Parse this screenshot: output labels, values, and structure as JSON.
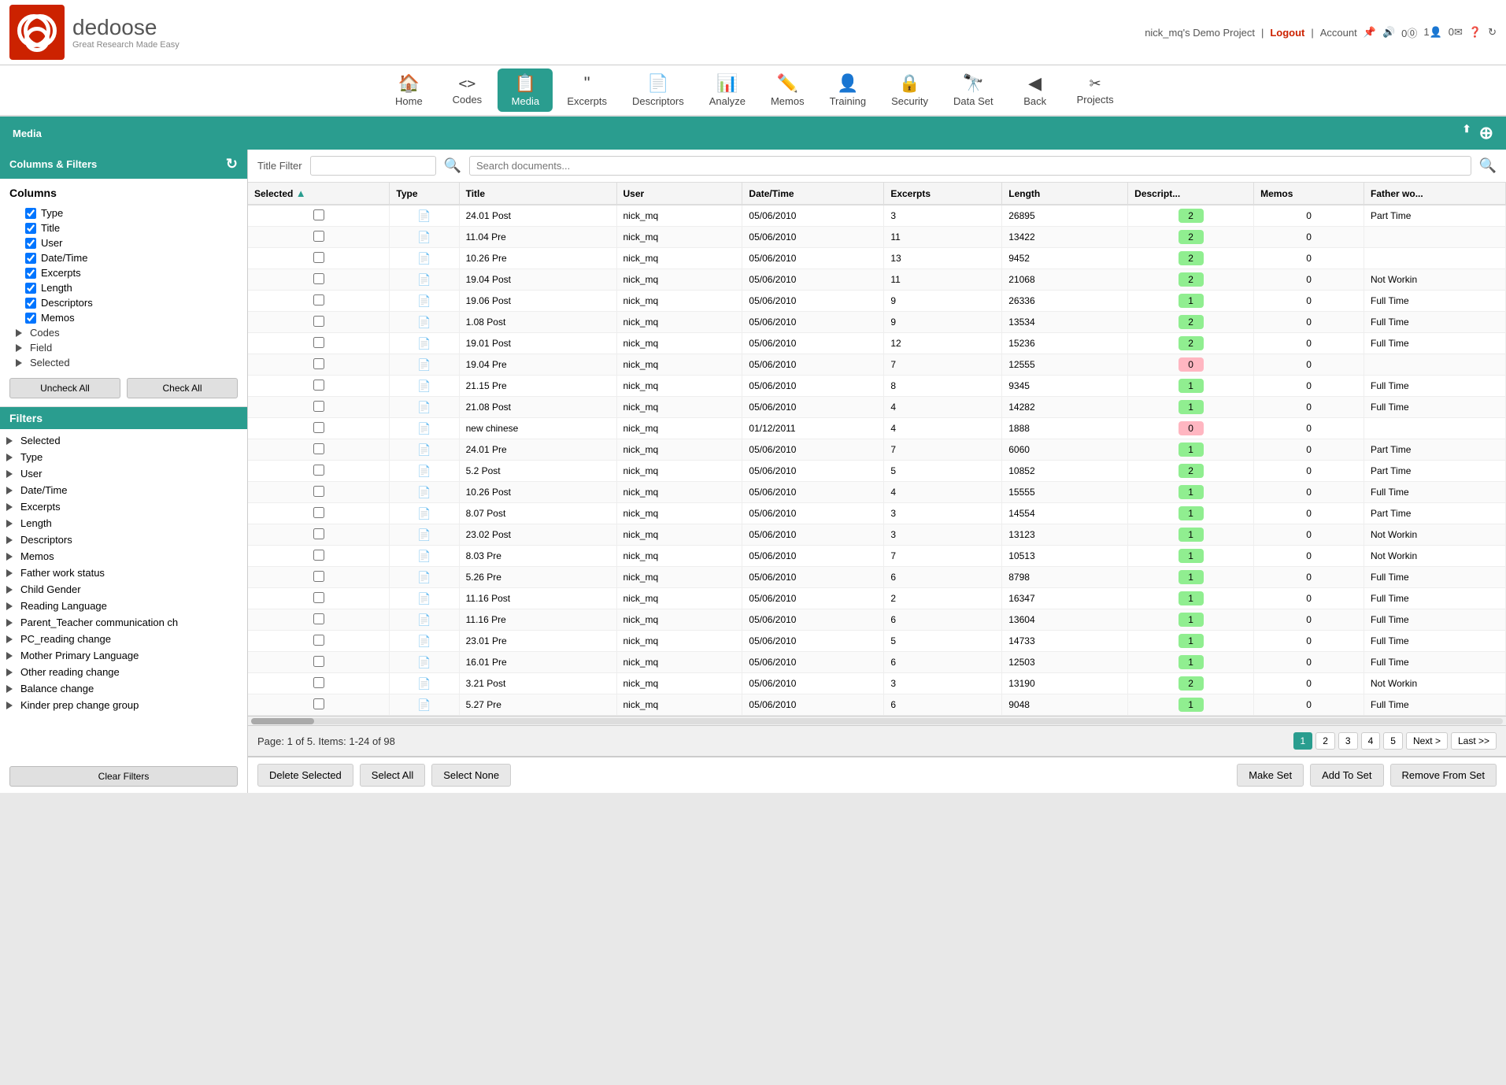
{
  "topbar": {
    "project": "nick_mq's Demo Project",
    "logout": "Logout",
    "account": "Account"
  },
  "nav": {
    "items": [
      {
        "id": "home",
        "label": "Home",
        "icon": "🏠"
      },
      {
        "id": "codes",
        "label": "Codes",
        "icon": "⟨⟩"
      },
      {
        "id": "media",
        "label": "Media",
        "icon": "📋",
        "active": true
      },
      {
        "id": "excerpts",
        "label": "Excerpts",
        "icon": "❝"
      },
      {
        "id": "descriptors",
        "label": "Descriptors",
        "icon": "📄"
      },
      {
        "id": "analyze",
        "label": "Analyze",
        "icon": "📊"
      },
      {
        "id": "memos",
        "label": "Memos",
        "icon": "✏️"
      },
      {
        "id": "training",
        "label": "Training",
        "icon": "👤"
      },
      {
        "id": "security",
        "label": "Security",
        "icon": "🔒"
      },
      {
        "id": "dataset",
        "label": "Data Set",
        "icon": "🔭"
      },
      {
        "id": "back",
        "label": "Back",
        "icon": "◀"
      },
      {
        "id": "projects",
        "label": "Projects",
        "icon": "✂"
      }
    ]
  },
  "media_header": {
    "title": "Media",
    "upload_icon": "⬆",
    "add_icon": "+"
  },
  "left_panel": {
    "filters_title": "Columns & Filters",
    "columns_title": "Columns",
    "columns": [
      {
        "label": "Type",
        "checked": true
      },
      {
        "label": "Title",
        "checked": true
      },
      {
        "label": "User",
        "checked": true
      },
      {
        "label": "Date/Time",
        "checked": true
      },
      {
        "label": "Excerpts",
        "checked": true
      },
      {
        "label": "Length",
        "checked": true
      },
      {
        "label": "Descriptors",
        "checked": true
      },
      {
        "label": "Memos",
        "checked": true
      }
    ],
    "col_groups": [
      {
        "label": "Codes"
      },
      {
        "label": "Field"
      },
      {
        "label": "Selected"
      }
    ],
    "uncheck_all": "Uncheck All",
    "check_all": "Check All",
    "filters_header": "Filters",
    "filter_items": [
      "Selected",
      "Type",
      "User",
      "Date/Time",
      "Excerpts",
      "Length",
      "Descriptors",
      "Memos",
      "Father work status",
      "Child Gender",
      "Reading Language",
      "Parent_Teacher communication ch",
      "PC_reading change",
      "Mother Primary Language",
      "Other reading change",
      "Balance change",
      "Kinder prep change group"
    ],
    "clear_filters": "Clear Filters"
  },
  "search_bar": {
    "title_filter_label": "Title Filter",
    "title_filter_placeholder": "",
    "search_placeholder": "Search documents..."
  },
  "table": {
    "headers": [
      "Selected",
      "Type",
      "Title",
      "User",
      "Date/Time",
      "Excerpts",
      "Length",
      "Descript...",
      "Memos",
      "Father wo..."
    ],
    "rows": [
      {
        "selected": false,
        "type": "doc",
        "title": "24.01 Post",
        "user": "nick_mq",
        "datetime": "05/06/2010",
        "excerpts": 3,
        "length": 26895,
        "descriptors": 2,
        "descriptors_color": "green",
        "memos": 0,
        "father": "Part Time"
      },
      {
        "selected": false,
        "type": "doc",
        "title": "11.04 Pre",
        "user": "nick_mq",
        "datetime": "05/06/2010",
        "excerpts": 11,
        "length": 13422,
        "descriptors": 2,
        "descriptors_color": "green",
        "memos": 0,
        "father": ""
      },
      {
        "selected": false,
        "type": "doc",
        "title": "10.26 Pre",
        "user": "nick_mq",
        "datetime": "05/06/2010",
        "excerpts": 13,
        "length": 9452,
        "descriptors": 2,
        "descriptors_color": "green",
        "memos": 0,
        "father": ""
      },
      {
        "selected": false,
        "type": "doc",
        "title": "19.04 Post",
        "user": "nick_mq",
        "datetime": "05/06/2010",
        "excerpts": 11,
        "length": 21068,
        "descriptors": 2,
        "descriptors_color": "green",
        "memos": 0,
        "father": "Not Workin"
      },
      {
        "selected": false,
        "type": "doc",
        "title": "19.06 Post",
        "user": "nick_mq",
        "datetime": "05/06/2010",
        "excerpts": 9,
        "length": 26336,
        "descriptors": 1,
        "descriptors_color": "green",
        "memos": 0,
        "father": "Full Time"
      },
      {
        "selected": false,
        "type": "doc",
        "title": "1.08 Post",
        "user": "nick_mq",
        "datetime": "05/06/2010",
        "excerpts": 9,
        "length": 13534,
        "descriptors": 2,
        "descriptors_color": "green",
        "memos": 0,
        "father": "Full Time"
      },
      {
        "selected": false,
        "type": "doc",
        "title": "19.01 Post",
        "user": "nick_mq",
        "datetime": "05/06/2010",
        "excerpts": 12,
        "length": 15236,
        "descriptors": 2,
        "descriptors_color": "green",
        "memos": 0,
        "father": "Full Time"
      },
      {
        "selected": false,
        "type": "doc",
        "title": "19.04 Pre",
        "user": "nick_mq",
        "datetime": "05/06/2010",
        "excerpts": 7,
        "length": 12555,
        "descriptors": 0,
        "descriptors_color": "pink",
        "memos": 0,
        "father": ""
      },
      {
        "selected": false,
        "type": "doc",
        "title": "21.15 Pre",
        "user": "nick_mq",
        "datetime": "05/06/2010",
        "excerpts": 8,
        "length": 9345,
        "descriptors": 1,
        "descriptors_color": "green",
        "memos": 0,
        "father": "Full Time"
      },
      {
        "selected": false,
        "type": "doc",
        "title": "21.08 Post",
        "user": "nick_mq",
        "datetime": "05/06/2010",
        "excerpts": 4,
        "length": 14282,
        "descriptors": 1,
        "descriptors_color": "green",
        "memos": 0,
        "father": "Full Time"
      },
      {
        "selected": false,
        "type": "doc",
        "title": "new chinese",
        "user": "nick_mq",
        "datetime": "01/12/2011",
        "excerpts": 4,
        "length": 1888,
        "descriptors": 0,
        "descriptors_color": "pink",
        "memos": 0,
        "father": ""
      },
      {
        "selected": false,
        "type": "doc",
        "title": "24.01 Pre",
        "user": "nick_mq",
        "datetime": "05/06/2010",
        "excerpts": 7,
        "length": 6060,
        "descriptors": 1,
        "descriptors_color": "green",
        "memos": 0,
        "father": "Part Time"
      },
      {
        "selected": false,
        "type": "doc",
        "title": "5.2 Post",
        "user": "nick_mq",
        "datetime": "05/06/2010",
        "excerpts": 5,
        "length": 10852,
        "descriptors": 2,
        "descriptors_color": "green",
        "memos": 0,
        "father": "Part Time"
      },
      {
        "selected": false,
        "type": "doc",
        "title": "10.26 Post",
        "user": "nick_mq",
        "datetime": "05/06/2010",
        "excerpts": 4,
        "length": 15555,
        "descriptors": 1,
        "descriptors_color": "green",
        "memos": 0,
        "father": "Full Time"
      },
      {
        "selected": false,
        "type": "doc",
        "title": "8.07 Post",
        "user": "nick_mq",
        "datetime": "05/06/2010",
        "excerpts": 3,
        "length": 14554,
        "descriptors": 1,
        "descriptors_color": "green",
        "memos": 0,
        "father": "Part Time"
      },
      {
        "selected": false,
        "type": "doc",
        "title": "23.02 Post",
        "user": "nick_mq",
        "datetime": "05/06/2010",
        "excerpts": 3,
        "length": 13123,
        "descriptors": 1,
        "descriptors_color": "green",
        "memos": 0,
        "father": "Not Workin"
      },
      {
        "selected": false,
        "type": "doc",
        "title": "8.03 Pre",
        "user": "nick_mq",
        "datetime": "05/06/2010",
        "excerpts": 7,
        "length": 10513,
        "descriptors": 1,
        "descriptors_color": "green",
        "memos": 0,
        "father": "Not Workin"
      },
      {
        "selected": false,
        "type": "doc",
        "title": "5.26 Pre",
        "user": "nick_mq",
        "datetime": "05/06/2010",
        "excerpts": 6,
        "length": 8798,
        "descriptors": 1,
        "descriptors_color": "green",
        "memos": 0,
        "father": "Full Time"
      },
      {
        "selected": false,
        "type": "doc",
        "title": "11.16 Post",
        "user": "nick_mq",
        "datetime": "05/06/2010",
        "excerpts": 2,
        "length": 16347,
        "descriptors": 1,
        "descriptors_color": "green",
        "memos": 0,
        "father": "Full Time"
      },
      {
        "selected": false,
        "type": "doc",
        "title": "11.16 Pre",
        "user": "nick_mq",
        "datetime": "05/06/2010",
        "excerpts": 6,
        "length": 13604,
        "descriptors": 1,
        "descriptors_color": "green",
        "memos": 0,
        "father": "Full Time"
      },
      {
        "selected": false,
        "type": "doc",
        "title": "23.01 Pre",
        "user": "nick_mq",
        "datetime": "05/06/2010",
        "excerpts": 5,
        "length": 14733,
        "descriptors": 1,
        "descriptors_color": "green",
        "memos": 0,
        "father": "Full Time"
      },
      {
        "selected": false,
        "type": "doc",
        "title": "16.01 Pre",
        "user": "nick_mq",
        "datetime": "05/06/2010",
        "excerpts": 6,
        "length": 12503,
        "descriptors": 1,
        "descriptors_color": "green",
        "memos": 0,
        "father": "Full Time"
      },
      {
        "selected": false,
        "type": "doc",
        "title": "3.21 Post",
        "user": "nick_mq",
        "datetime": "05/06/2010",
        "excerpts": 3,
        "length": 13190,
        "descriptors": 2,
        "descriptors_color": "green",
        "memos": 0,
        "father": "Not Workin"
      },
      {
        "selected": false,
        "type": "doc",
        "title": "5.27 Pre",
        "user": "nick_mq",
        "datetime": "05/06/2010",
        "excerpts": 6,
        "length": 9048,
        "descriptors": 1,
        "descriptors_color": "green",
        "memos": 0,
        "father": "Full Time"
      }
    ]
  },
  "bottom_bar": {
    "page_info": "Page: 1 of 5. Items: 1-24 of 98",
    "pages": [
      "1",
      "2",
      "3",
      "4",
      "5"
    ],
    "next": "Next >",
    "last": "Last >>"
  },
  "action_bar": {
    "delete_selected": "Delete Selected",
    "select_all": "Select All",
    "select_none": "Select None",
    "make_set": "Make Set",
    "add_to_set": "Add To Set",
    "remove_from_set": "Remove From Set"
  }
}
